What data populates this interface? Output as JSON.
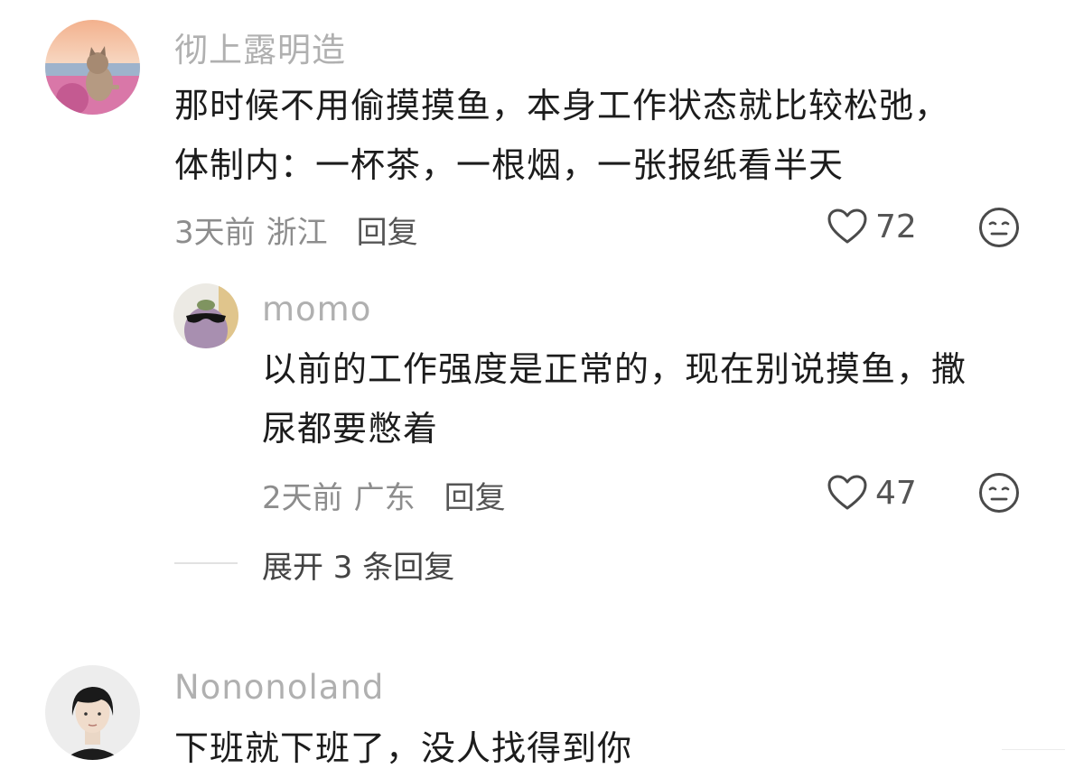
{
  "comments": [
    {
      "username": "彻上露明造",
      "lines": [
        "那时候不用偷摸摸鱼，本身工作状态就比较松弛，",
        "体制内：一杯茶，一根烟，一张报纸看半天"
      ],
      "time": "3天前",
      "location": "浙江",
      "reply_label": "回复",
      "likes": "72",
      "avatar": "cat-in-pink-car"
    },
    {
      "username": "momo",
      "lines": [
        "以前的工作强度是正常的，现在别说摸鱼，撒",
        "尿都要憋着"
      ],
      "time": "2天前",
      "location": "广东",
      "reply_label": "回复",
      "likes": "47",
      "avatar": "eggplant-with-sunglasses"
    },
    {
      "username": "Nononoland",
      "lines": [
        "下班就下班了，没人找得到你"
      ],
      "avatar": "short-hair-person"
    }
  ],
  "expand_replies": "展开 3 条回复",
  "icons": {
    "like": "heart-outline-icon",
    "dislike": "meh-face-icon"
  },
  "colors": {
    "username": "#b0b0b0",
    "text": "#1c1c1c",
    "meta": "#8d8d8d"
  }
}
